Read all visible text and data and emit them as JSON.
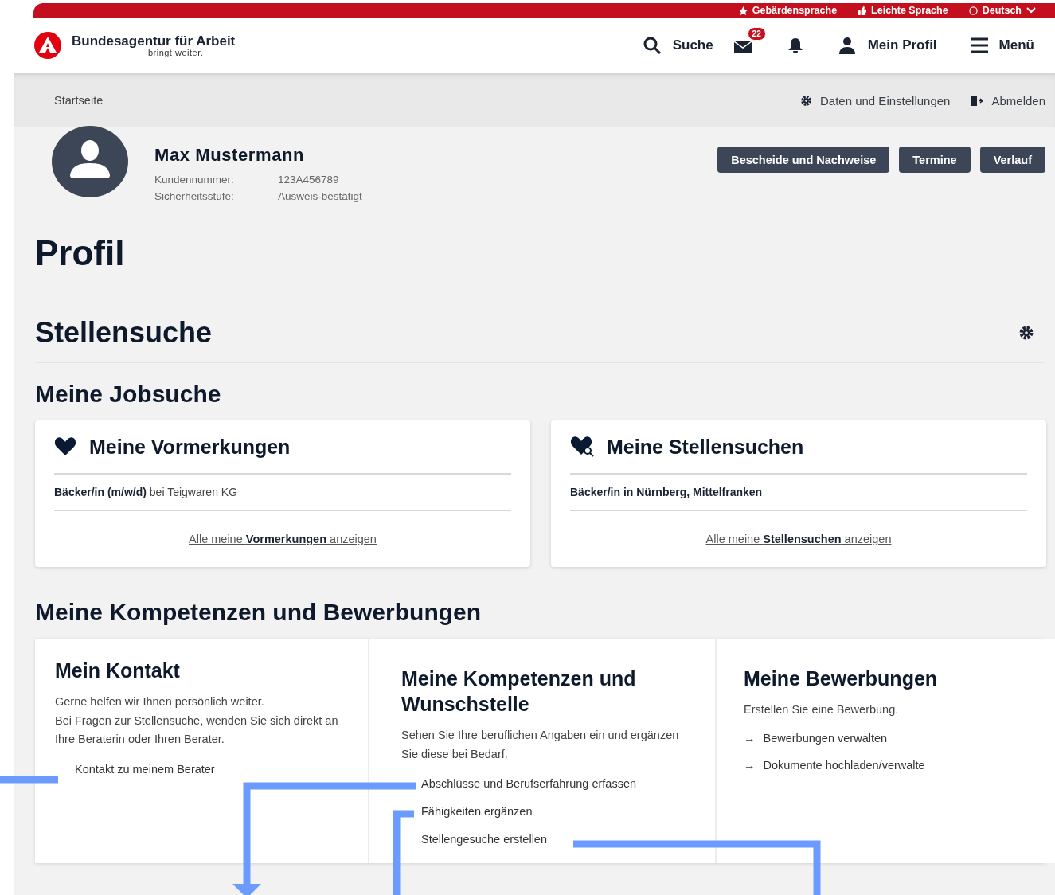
{
  "top_bar": {
    "links": [
      {
        "kind": "sign",
        "label": "Gebärdensprache"
      },
      {
        "kind": "easy",
        "label": "Leichte Sprache"
      },
      {
        "kind": "language",
        "label": "Deutsch"
      }
    ]
  },
  "header": {
    "logo_title": "Bundesagentur für Arbeit",
    "logo_tagline": "bringt weiter.",
    "nav": [
      {
        "kind": "search",
        "label": "Suche"
      },
      {
        "kind": "mail",
        "badge": "22"
      },
      {
        "kind": "bell"
      },
      {
        "kind": "profile",
        "label": "Mein Profil"
      },
      {
        "kind": "menu",
        "label": "Menü"
      }
    ]
  },
  "breadcrumb": "Startseite",
  "account_links": [
    {
      "kind": "settings",
      "label": "Daten und Einstellungen"
    },
    {
      "kind": "logout",
      "label": "Abmelden"
    }
  ],
  "user": {
    "name": "Max Mustermann",
    "fields": [
      {
        "label": "Kundennummer:",
        "value": "123A456789"
      },
      {
        "label": "Sicherheitsstufe:",
        "value": "Ausweis-bestätigt"
      }
    ]
  },
  "actions": [
    "Bescheide und Nachweise",
    "Termine",
    "Verlauf"
  ],
  "page_title": "Profil",
  "section_title": "Stellensuche",
  "jobsearch": {
    "title": "Meine Jobsuche",
    "cards": [
      {
        "kind": "heart",
        "title": "Meine Vormerkungen",
        "item": "**Bäcker/in (m/w/d)** bei Teigwaren KG",
        "link": "Alle meine **Vormerkungen** anzeigen"
      },
      {
        "kind": "heart-search",
        "title": "Meine Stellensuchen",
        "item": "**Bäcker/in in Nürnberg, Mittelfranken**",
        "link": "Alle meine **Stellensuchen** anzeigen"
      }
    ]
  },
  "competences": {
    "title": "Meine Kompetenzen und Bewerbungen",
    "cards": [
      {
        "title": "Mein Kontakt",
        "text": "Gerne helfen wir Ihnen persönlich weiter.\nBei Fragen zur Stellensuche, wenden Sie sich direkt an Ihre Beraterin oder Ihren Berater.",
        "links": [
          {
            "kind": "plain",
            "label": "Kontakt zu meinem Berater"
          }
        ]
      },
      {
        "title": "Meine Kompetenzen und Wunschstelle",
        "text": "Sehen Sie Ihre beruflichen Angaben ein und ergänzen Sie diese bei Bedarf.",
        "links": [
          {
            "kind": "plain",
            "label": "Abschlüsse und Berufserfahrung erfassen"
          },
          {
            "kind": "plain",
            "label": "Fähigkeiten ergänzen"
          },
          {
            "kind": "plain",
            "label": "Stellengesuche erstellen"
          }
        ]
      },
      {
        "title": "Meine Bewerbungen",
        "text": "Erstellen Sie eine Bewerbung.",
        "links": [
          {
            "kind": "arrow",
            "marker": "→",
            "label": "Bewerbungen verwalten"
          },
          {
            "kind": "arrow",
            "marker": "→",
            "label": "Dokumente hochladen/verwalte"
          }
        ]
      }
    ]
  }
}
